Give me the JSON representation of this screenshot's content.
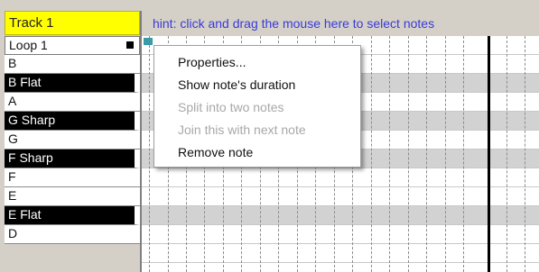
{
  "track": {
    "title": "Track 1"
  },
  "keys": [
    {
      "label": "Loop 1",
      "kind": "loop"
    },
    {
      "label": "B",
      "kind": "white"
    },
    {
      "label": "B Flat",
      "kind": "black"
    },
    {
      "label": "A",
      "kind": "white"
    },
    {
      "label": "G Sharp",
      "kind": "black"
    },
    {
      "label": "G",
      "kind": "white"
    },
    {
      "label": "F Sharp",
      "kind": "black"
    },
    {
      "label": "F",
      "kind": "white"
    },
    {
      "label": "E",
      "kind": "white"
    },
    {
      "label": "E Flat",
      "kind": "black"
    },
    {
      "label": "D",
      "kind": "white"
    }
  ],
  "grid": {
    "hint": "hint:  click and drag the mouse here to select notes"
  },
  "context_menu": {
    "items": [
      {
        "label": "Properties...",
        "enabled": true
      },
      {
        "label": "Show note's duration",
        "enabled": true
      },
      {
        "label": "Split into two notes",
        "enabled": false
      },
      {
        "label": "Join this with next note",
        "enabled": false
      },
      {
        "label": "Remove note",
        "enabled": true
      }
    ]
  },
  "colors": {
    "track_header": "#ffff00",
    "hint_text": "#3a3ad8",
    "note_marker": "#3a9aa8",
    "black_key": "#000000",
    "dark_row": "#d2d2d2"
  }
}
